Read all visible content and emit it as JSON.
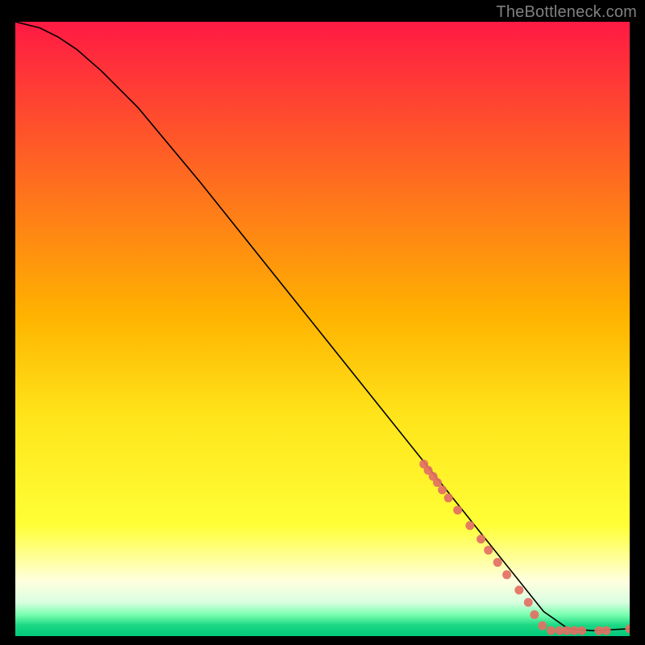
{
  "attribution": "TheBottleneck.com",
  "colors": {
    "black": "#000000",
    "curve": "#000000",
    "point_fill": "#e37063",
    "grad_top": "#ff1a44",
    "grad_mid": "#ffd300",
    "grad_yellow2": "#ffff37",
    "grad_pale": "#ffffdf",
    "grad_mint": "#b4ffcf",
    "grad_green": "#1dd884",
    "grad_green2": "#00c97a"
  },
  "chart_data": {
    "type": "line",
    "title": "",
    "xlabel": "",
    "ylabel": "",
    "xlim": [
      0,
      100
    ],
    "ylim": [
      0,
      100
    ],
    "grid": false,
    "legend": false,
    "series": [
      {
        "name": "bottleneck-curve",
        "x": [
          0,
          4,
          7,
          10,
          14,
          20,
          30,
          40,
          50,
          60,
          66,
          70,
          74,
          78,
          82,
          84,
          86,
          90,
          94,
          100
        ],
        "y": [
          100,
          99,
          97.5,
          95.5,
          92,
          86,
          74,
          61.5,
          49,
          36.5,
          29,
          24,
          19,
          14,
          9,
          6.5,
          4,
          1.2,
          0.9,
          1.2
        ]
      }
    ],
    "points": [
      {
        "x": 66.5,
        "y": 28.0
      },
      {
        "x": 67.2,
        "y": 27.0
      },
      {
        "x": 68.0,
        "y": 26.0
      },
      {
        "x": 68.7,
        "y": 25.0
      },
      {
        "x": 69.5,
        "y": 23.8
      },
      {
        "x": 70.5,
        "y": 22.5
      },
      {
        "x": 72.0,
        "y": 20.5
      },
      {
        "x": 74.0,
        "y": 18.0
      },
      {
        "x": 75.8,
        "y": 15.8
      },
      {
        "x": 77.0,
        "y": 14.0
      },
      {
        "x": 78.5,
        "y": 12.0
      },
      {
        "x": 80.0,
        "y": 10.0
      },
      {
        "x": 82.0,
        "y": 7.5
      },
      {
        "x": 83.5,
        "y": 5.5
      },
      {
        "x": 84.5,
        "y": 3.5
      },
      {
        "x": 85.8,
        "y": 1.7
      },
      {
        "x": 87.2,
        "y": 0.9
      },
      {
        "x": 88.6,
        "y": 0.9
      },
      {
        "x": 89.8,
        "y": 0.9
      },
      {
        "x": 91.0,
        "y": 0.9
      },
      {
        "x": 92.2,
        "y": 0.9
      },
      {
        "x": 95.0,
        "y": 0.9
      },
      {
        "x": 96.2,
        "y": 0.9
      },
      {
        "x": 100.0,
        "y": 1.2
      }
    ],
    "point_radius": 5.5
  }
}
